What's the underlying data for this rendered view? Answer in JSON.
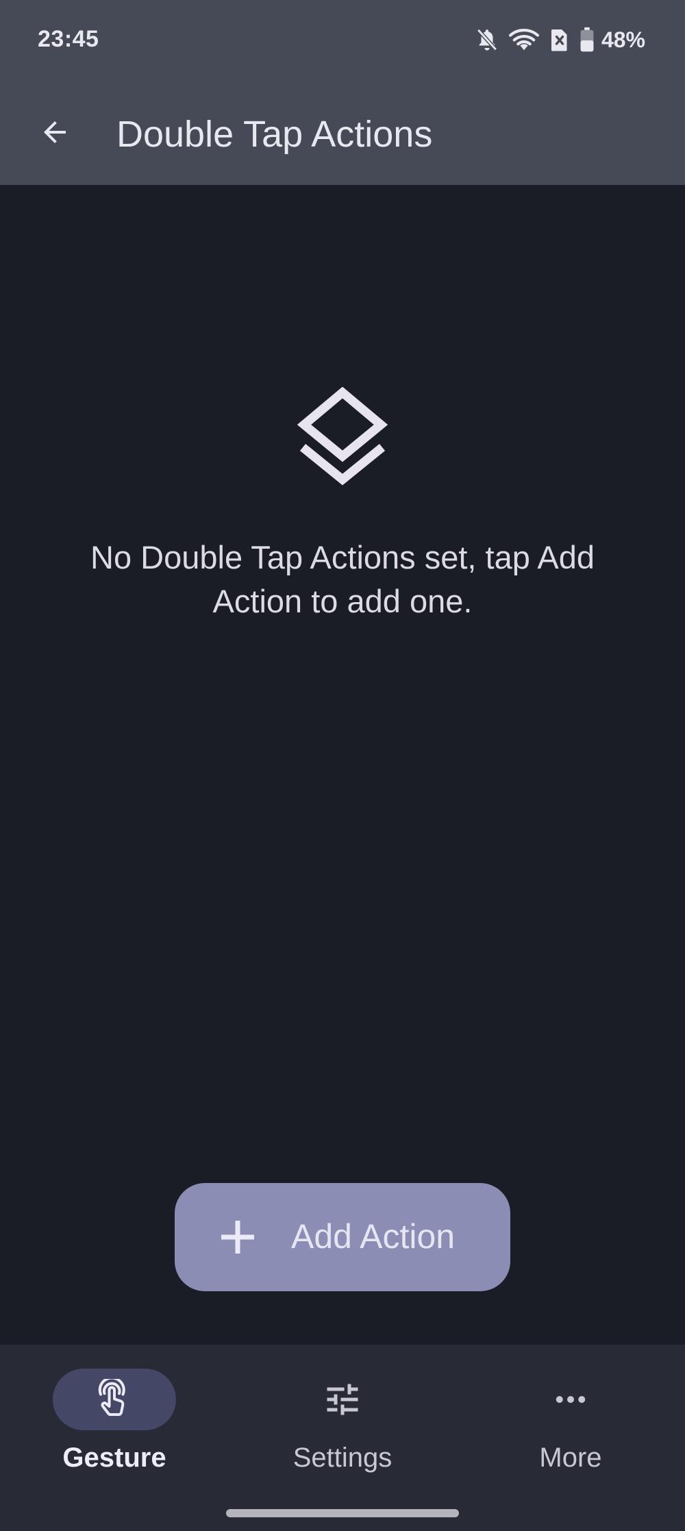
{
  "status_bar": {
    "time": "23:45",
    "battery_percent": "48%",
    "icons": [
      "notifications-off-icon",
      "wifi-icon",
      "no-sim-icon",
      "battery-icon"
    ]
  },
  "app_bar": {
    "title": "Double Tap Actions",
    "back_icon": "arrow-back-icon"
  },
  "empty_state": {
    "icon": "layers-icon",
    "message": "No Double Tap Actions set, tap Add Action to add one."
  },
  "fab": {
    "icon": "plus-icon",
    "label": "Add Action"
  },
  "bottom_nav": {
    "items": [
      {
        "label": "Gesture",
        "icon": "touch-icon",
        "selected": true
      },
      {
        "label": "Settings",
        "icon": "tune-icon",
        "selected": false
      },
      {
        "label": "More",
        "icon": "more-horiz-icon",
        "selected": false
      }
    ]
  },
  "colors": {
    "background": "#1a1c26",
    "app_bar": "#464a56",
    "fab": "#8b8db5",
    "nav_bar": "#282b36",
    "nav_indicator": "#444766"
  }
}
